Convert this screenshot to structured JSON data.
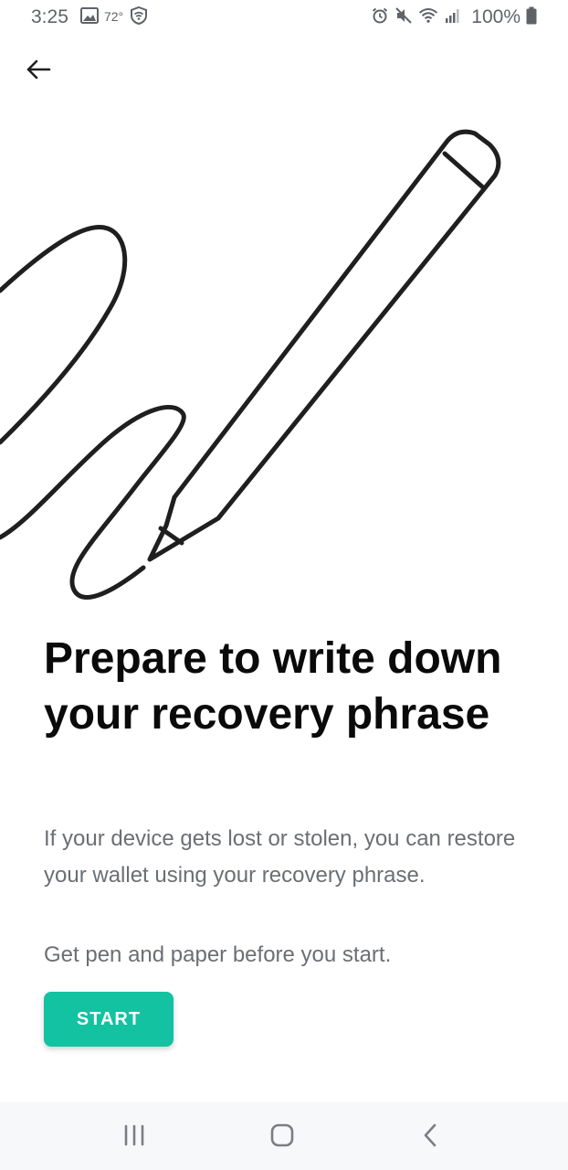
{
  "status_bar": {
    "time": "3:25",
    "temperature": "72°",
    "battery": "100%",
    "icons": [
      "image-icon",
      "shield-wifi-icon",
      "alarm-icon",
      "mute-icon",
      "wifi-icon",
      "signal-icon",
      "battery-icon"
    ]
  },
  "header": {
    "back_icon": "arrow-left-icon"
  },
  "illustration": {
    "name": "pen-writing-illustration",
    "stroke_color": "#1f1f1f"
  },
  "content": {
    "title": "Prepare to write down your recovery phrase",
    "description": "If your device gets lost or stolen, you can restore your wallet using your recovery phrase.",
    "instruction": "Get pen and paper before you start.",
    "start_label": "START"
  },
  "nav_bar": {
    "recents_icon": "recents-icon",
    "home_icon": "home-icon",
    "back_icon": "back-chevron-icon"
  },
  "colors": {
    "accent": "#12c2a0",
    "title": "#0a0a0a",
    "body": "#6b6f73",
    "nav_bg": "#f7f8fa"
  }
}
